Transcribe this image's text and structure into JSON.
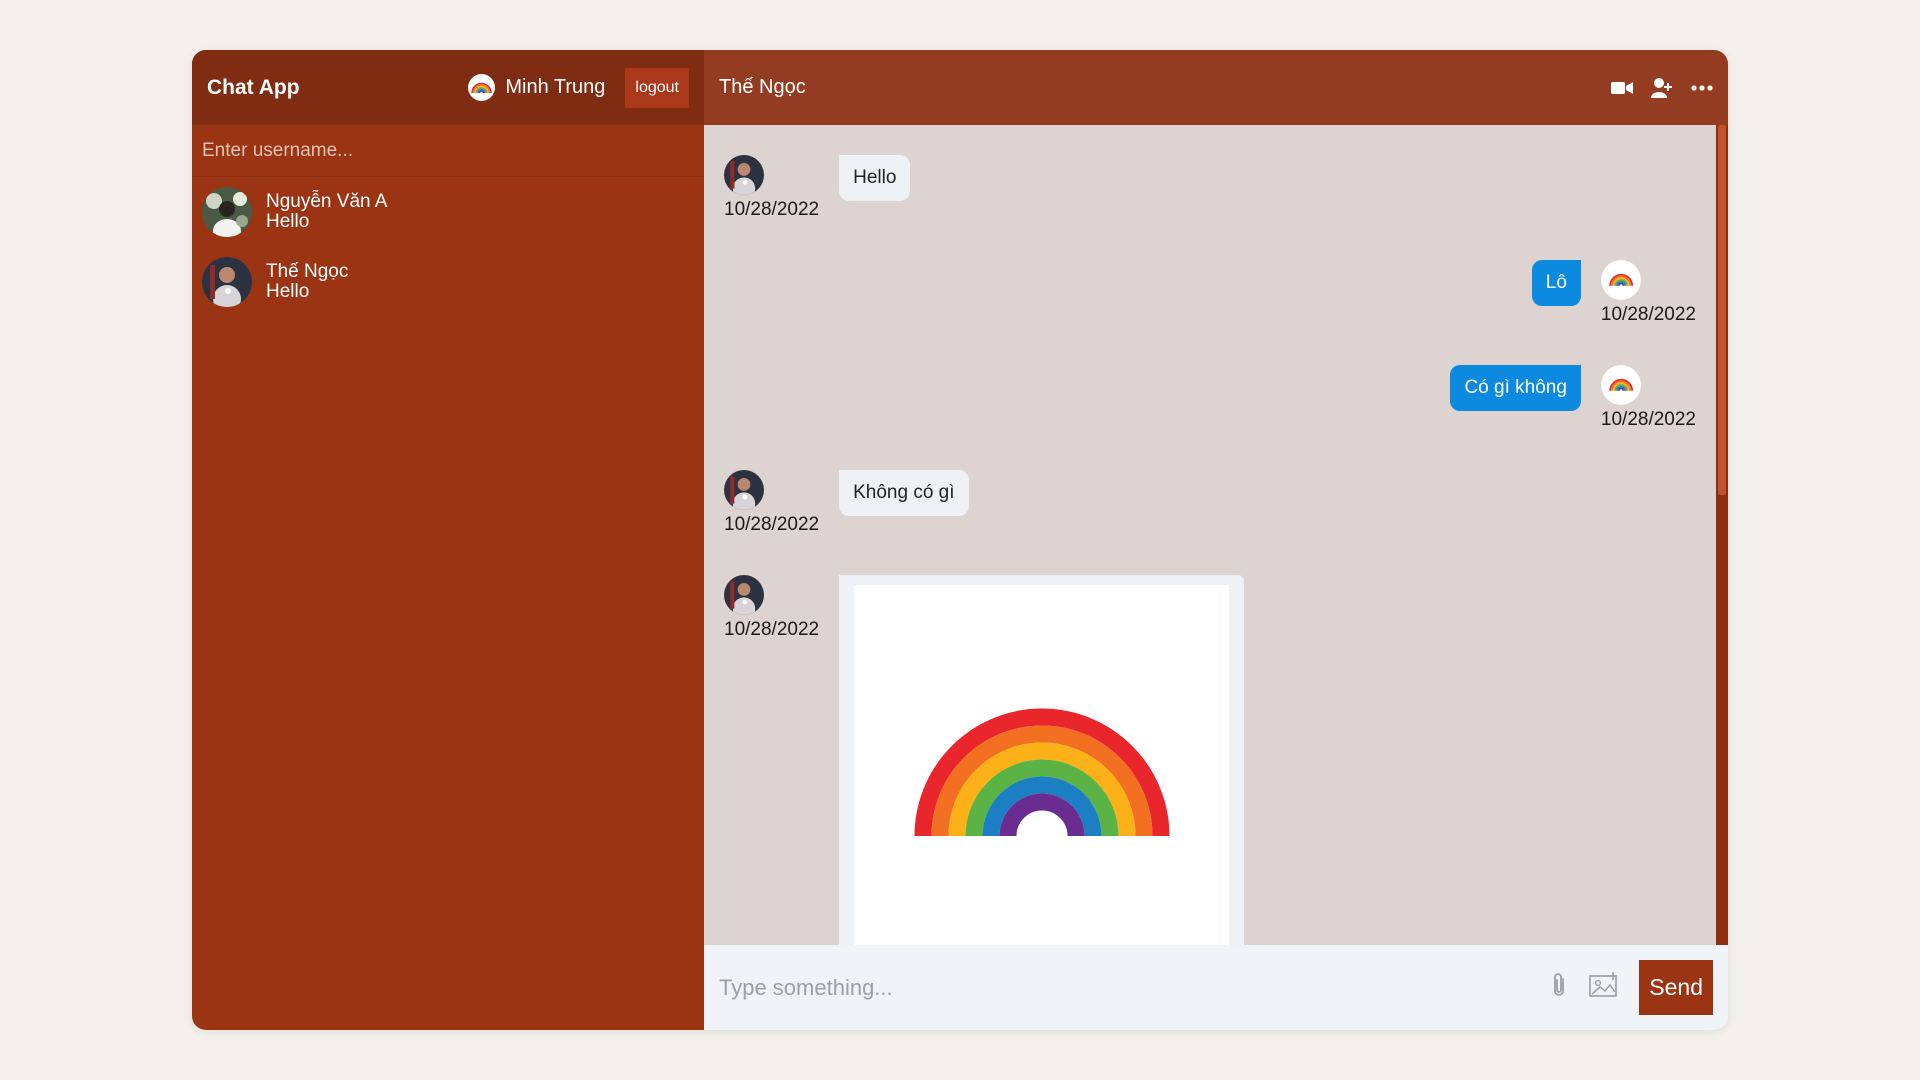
{
  "sidebar": {
    "app_title": "Chat App",
    "current_user": {
      "name": "Minh Trung",
      "avatar": "rainbow-avatar"
    },
    "logout_label": "logout",
    "search": {
      "placeholder": "Enter username...",
      "value": ""
    },
    "contacts": [
      {
        "name": "Nguyễn Văn A",
        "last_message": "Hello",
        "avatar": "photo-avatar"
      },
      {
        "name": "Thế Ngọc",
        "last_message": "Hello",
        "avatar": "photo-avatar"
      }
    ]
  },
  "chat": {
    "title": "Thế Ngọc",
    "header_icons": [
      "video-camera-icon",
      "add-user-icon",
      "more-icon"
    ],
    "messages": [
      {
        "owner": false,
        "text": "Hello",
        "date": "10/28/2022"
      },
      {
        "owner": true,
        "text": "Lô",
        "date": "10/28/2022"
      },
      {
        "owner": true,
        "text": "Có gì không",
        "date": "10/28/2022"
      },
      {
        "owner": false,
        "text": "Không có gì",
        "date": "10/28/2022"
      },
      {
        "owner": false,
        "image": "rainbow-image",
        "date": "10/28/2022"
      }
    ],
    "input": {
      "placeholder": "Type something...",
      "value": ""
    },
    "input_icons": [
      "paperclip-icon",
      "image-icon"
    ],
    "send_label": "Send"
  },
  "colors": {
    "sidebar_bg": "#9b3413",
    "sidebar_header_bg": "#7f2c12",
    "chat_header_bg": "#943c22",
    "chat_bg": "#ddd3d1",
    "owner_bubble": "#0b8ae0",
    "other_bubble": "#eef1f5",
    "send_button": "#9b3413"
  }
}
